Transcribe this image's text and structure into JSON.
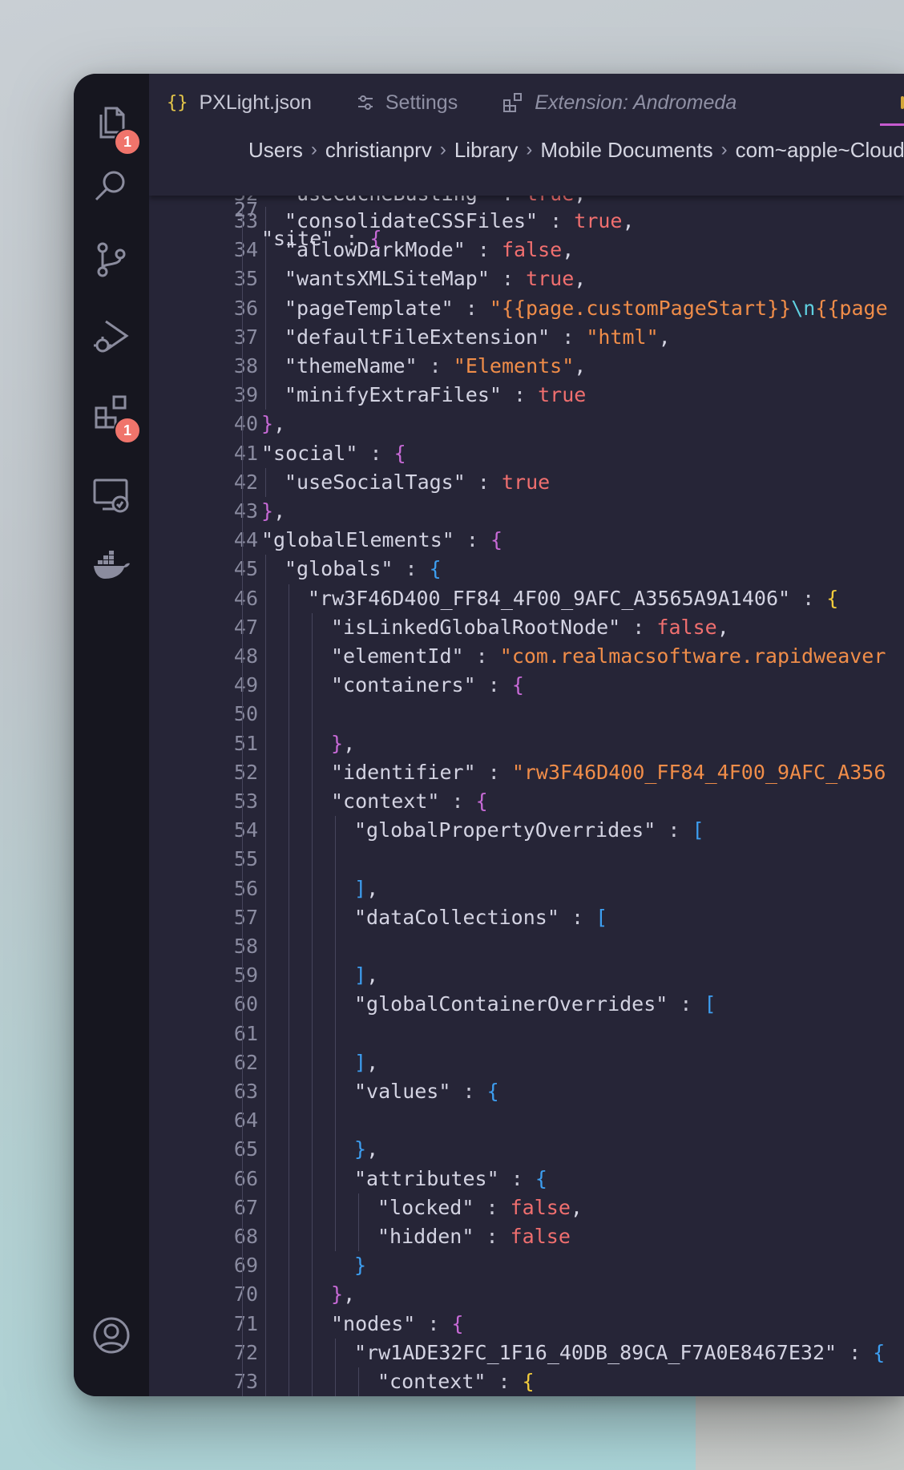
{
  "tabs": [
    {
      "icon": "braces-icon",
      "label": "PXLight.json",
      "active": true
    },
    {
      "icon": "settings-sliders-icon",
      "label": "Settings",
      "active": false
    },
    {
      "icon": "extensions-icon",
      "label": "Extension: Andromeda",
      "active": false
    }
  ],
  "breadcrumb": [
    "Users",
    "christianprv",
    "Library",
    "Mobile Documents",
    "com~apple~CloudDo"
  ],
  "activity_bar": {
    "explorer_badge": "1",
    "extensions_badge": "1",
    "icons": [
      "files-icon",
      "search-icon",
      "source-control-icon",
      "run-debug-icon",
      "extensions-icon",
      "remote-explorer-icon",
      "docker-icon",
      "account-icon"
    ]
  },
  "sticky_line": {
    "num": "27",
    "text": "\"site\" : {"
  },
  "partial_line": {
    "num": "32",
    "text": "\"useCacheBusting\" : true,"
  },
  "lines": [
    {
      "num": "33",
      "indent": 2,
      "text": "\"consolidateCSSFiles\" : true,"
    },
    {
      "num": "34",
      "indent": 2,
      "text": "\"allowDarkMode\" : false,"
    },
    {
      "num": "35",
      "indent": 2,
      "text": "\"wantsXMLSiteMap\" : true,"
    },
    {
      "num": "36",
      "indent": 2,
      "text": "\"pageTemplate\" : \"{{page.customPageStart}}\\n{{page"
    },
    {
      "num": "37",
      "indent": 2,
      "text": "\"defaultFileExtension\" : \"html\","
    },
    {
      "num": "38",
      "indent": 2,
      "text": "\"themeName\" : \"Elements\","
    },
    {
      "num": "39",
      "indent": 2,
      "text": "\"minifyExtraFiles\" : true"
    },
    {
      "num": "40",
      "indent": 1,
      "text": "},"
    },
    {
      "num": "41",
      "indent": 1,
      "text": "\"social\" : {"
    },
    {
      "num": "42",
      "indent": 2,
      "text": "\"useSocialTags\" : true"
    },
    {
      "num": "43",
      "indent": 1,
      "text": "},"
    },
    {
      "num": "44",
      "indent": 1,
      "text": "\"globalElements\" : {"
    },
    {
      "num": "45",
      "indent": 2,
      "text": "\"globals\" : {"
    },
    {
      "num": "46",
      "indent": 3,
      "text": "\"rw3F46D400_FF84_4F00_9AFC_A3565A9A1406\" : {"
    },
    {
      "num": "47",
      "indent": 4,
      "text": "\"isLinkedGlobalRootNode\" : false,"
    },
    {
      "num": "48",
      "indent": 4,
      "text": "\"elementId\" : \"com.realmacsoftware.rapidweaver"
    },
    {
      "num": "49",
      "indent": 4,
      "text": "\"containers\" : {"
    },
    {
      "num": "50",
      "indent": 4,
      "text": ""
    },
    {
      "num": "51",
      "indent": 4,
      "text": "},"
    },
    {
      "num": "52",
      "indent": 4,
      "text": "\"identifier\" : \"rw3F46D400_FF84_4F00_9AFC_A356"
    },
    {
      "num": "53",
      "indent": 4,
      "text": "\"context\" : {"
    },
    {
      "num": "54",
      "indent": 5,
      "text": "\"globalPropertyOverrides\" : ["
    },
    {
      "num": "55",
      "indent": 5,
      "text": ""
    },
    {
      "num": "56",
      "indent": 5,
      "text": "],"
    },
    {
      "num": "57",
      "indent": 5,
      "text": "\"dataCollections\" : ["
    },
    {
      "num": "58",
      "indent": 5,
      "text": ""
    },
    {
      "num": "59",
      "indent": 5,
      "text": "],"
    },
    {
      "num": "60",
      "indent": 5,
      "text": "\"globalContainerOverrides\" : ["
    },
    {
      "num": "61",
      "indent": 5,
      "text": ""
    },
    {
      "num": "62",
      "indent": 5,
      "text": "],"
    },
    {
      "num": "63",
      "indent": 5,
      "text": "\"values\" : {"
    },
    {
      "num": "64",
      "indent": 5,
      "text": ""
    },
    {
      "num": "65",
      "indent": 5,
      "text": "},"
    },
    {
      "num": "66",
      "indent": 5,
      "text": "\"attributes\" : {"
    },
    {
      "num": "67",
      "indent": 6,
      "text": "\"locked\" : false,"
    },
    {
      "num": "68",
      "indent": 6,
      "text": "\"hidden\" : false"
    },
    {
      "num": "69",
      "indent": 5,
      "text": "}"
    },
    {
      "num": "70",
      "indent": 4,
      "text": "},"
    },
    {
      "num": "71",
      "indent": 4,
      "text": "\"nodes\" : {"
    },
    {
      "num": "72",
      "indent": 5,
      "text": "\"rw1ADE32FC_1F16_40DB_89CA_F7A0E8467E32\" : {"
    },
    {
      "num": "73",
      "indent": 6,
      "text": "\"context\" : {"
    }
  ],
  "colors": {
    "string": "#f08d49",
    "boolean": "#f06f6f",
    "bracket_level1": "#c76ad6",
    "bracket_level2": "#3d9ef0",
    "bracket_level3": "#f2cc3c",
    "escape": "#5fd0e0",
    "badge": "#f0746b"
  }
}
